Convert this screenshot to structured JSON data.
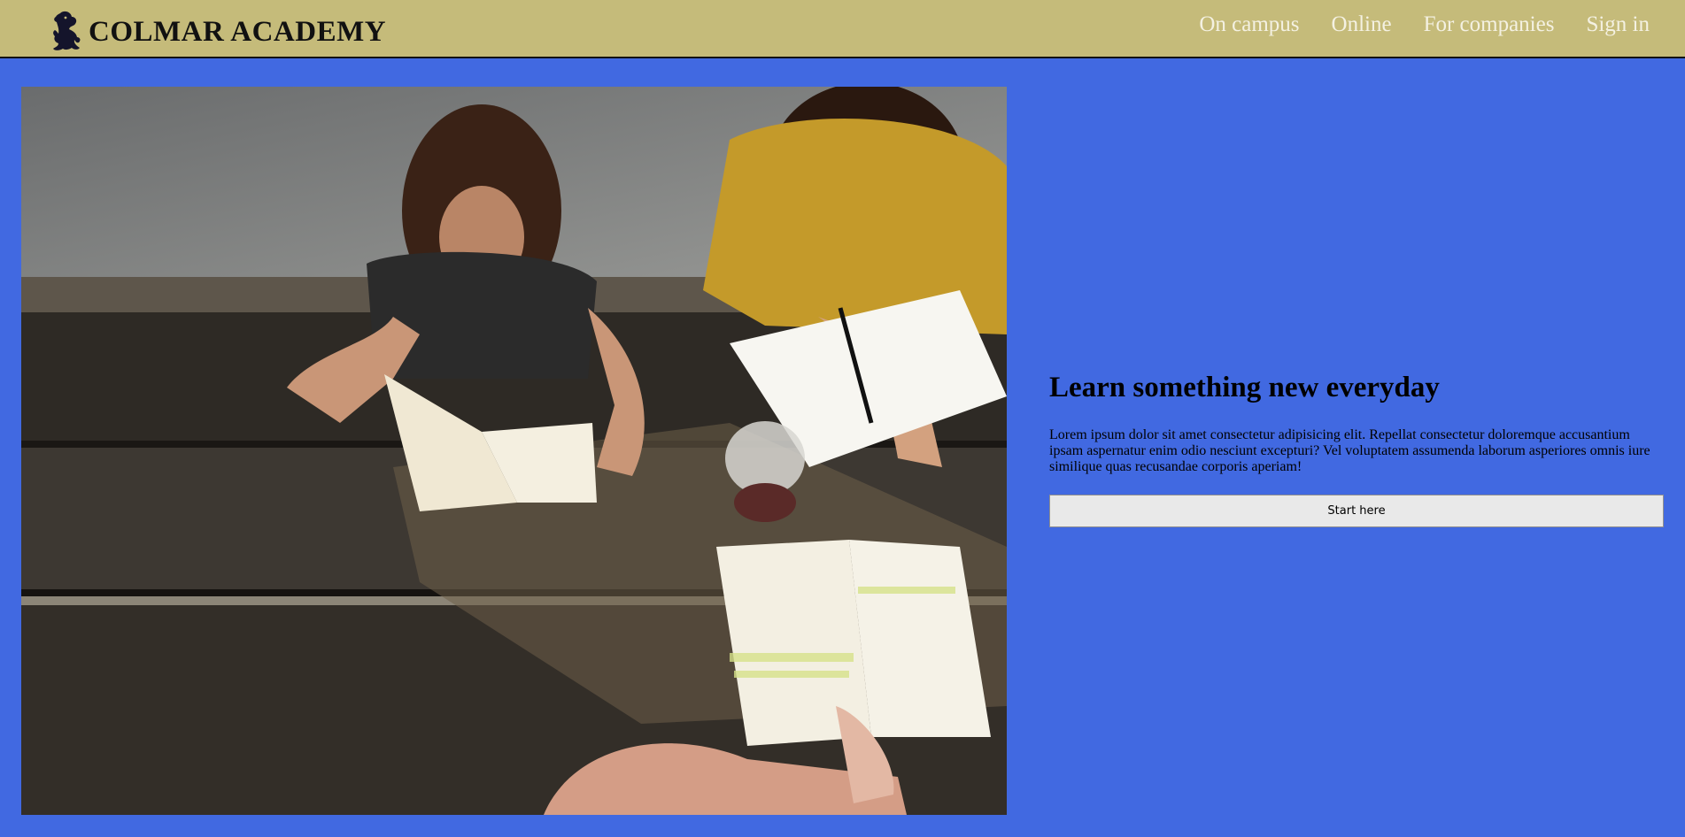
{
  "header": {
    "brand_name": "COLMAR ACADEMY",
    "logo_icon": "lion-rampant-icon",
    "colors": {
      "background": "#c5bb7a",
      "nav_text": "#f4f1e2",
      "brand_text": "#111111"
    },
    "nav": [
      {
        "label": "On campus"
      },
      {
        "label": "Online"
      },
      {
        "label": "For companies"
      },
      {
        "label": "Sign in"
      }
    ]
  },
  "hero": {
    "image_icon": "students-studying-photo",
    "title": "Learn something new everyday",
    "text": "Lorem ipsum dolor sit amet consectetur adipisicing elit. Repellat consectetur doloremque accusantium ipsam aspernatur enim odio nesciunt excepturi? Vel voluptatem assumenda laborum asperiores omnis iure similique quas recusandae corporis aperiam!",
    "button_label": "Start here",
    "colors": {
      "page_background": "#4169e1",
      "button_background": "#e9e9e9"
    }
  }
}
